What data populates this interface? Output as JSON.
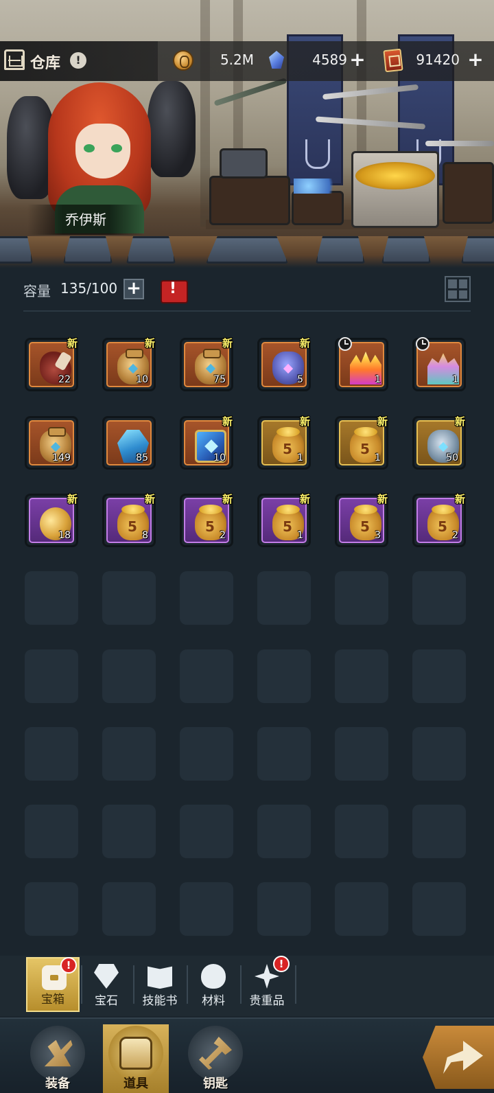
{
  "header": {
    "title": "仓库",
    "info_glyph": "!",
    "gold": "5.2M",
    "gems": "4589",
    "tickets": "91420",
    "plus_glyph": "+"
  },
  "character": {
    "name": "乔伊斯"
  },
  "capacity": {
    "label": "容量",
    "value": "135/100",
    "plus_glyph": "+",
    "alert_glyph": "!"
  },
  "new_label": "新",
  "items": [
    {
      "icon": "meat-icon",
      "rarity": "orange",
      "qty": "22",
      "new": true,
      "timer": false
    },
    {
      "icon": "gold-jar-icon",
      "rarity": "orange",
      "qty": "10",
      "new": true,
      "timer": false
    },
    {
      "icon": "gold-jar-icon",
      "rarity": "orange",
      "qty": "75",
      "new": true,
      "timer": false
    },
    {
      "icon": "dark-jar-icon",
      "rarity": "orange",
      "qty": "5",
      "new": true,
      "timer": false
    },
    {
      "icon": "flame-chest-icon",
      "rarity": "orange",
      "qty": "1",
      "new": false,
      "timer": true
    },
    {
      "icon": "gem-chest-icon",
      "rarity": "orange",
      "qty": "1",
      "new": false,
      "timer": true
    },
    {
      "icon": "gold-jar-icon",
      "rarity": "orange",
      "qty": "149",
      "new": false,
      "timer": false
    },
    {
      "icon": "crystal-icon",
      "rarity": "orange",
      "qty": "85",
      "new": false,
      "timer": false
    },
    {
      "icon": "magic-box-icon",
      "rarity": "orange",
      "qty": "10",
      "new": true,
      "timer": false
    },
    {
      "icon": "coin-bag-icon",
      "rarity": "gold",
      "qty": "1",
      "new": true,
      "timer": false
    },
    {
      "icon": "coin-bag-icon",
      "rarity": "gold",
      "qty": "1",
      "new": true,
      "timer": false
    },
    {
      "icon": "steel-jar-icon",
      "rarity": "gold",
      "qty": "50",
      "new": true,
      "timer": false
    },
    {
      "icon": "coin-stack-icon",
      "rarity": "purple",
      "qty": "18",
      "new": true,
      "timer": false
    },
    {
      "icon": "coin-bag-icon",
      "rarity": "purple",
      "qty": "8",
      "new": true,
      "timer": false
    },
    {
      "icon": "coin-bag-icon",
      "rarity": "purple",
      "qty": "2",
      "new": true,
      "timer": false
    },
    {
      "icon": "coin-bag-icon",
      "rarity": "purple",
      "qty": "1",
      "new": true,
      "timer": false
    },
    {
      "icon": "coin-bag-icon",
      "rarity": "purple",
      "qty": "3",
      "new": true,
      "timer": false
    },
    {
      "icon": "coin-bag-icon",
      "rarity": "purple",
      "qty": "2",
      "new": true,
      "timer": false
    }
  ],
  "categories": [
    {
      "label": "宝箱",
      "icon": "chest-icon",
      "active": true,
      "badge": "!"
    },
    {
      "label": "宝石",
      "icon": "gem-icon",
      "active": false,
      "badge": ""
    },
    {
      "label": "技能书",
      "icon": "book-icon",
      "active": false,
      "badge": ""
    },
    {
      "label": "材料",
      "icon": "material-icon",
      "active": false,
      "badge": ""
    },
    {
      "label": "贵重品",
      "icon": "star-icon",
      "active": false,
      "badge": "!"
    }
  ],
  "nav": [
    {
      "label": "装备",
      "icon": "equipment-icon",
      "active": false
    },
    {
      "label": "道具",
      "icon": "item-icon",
      "active": true
    },
    {
      "label": "钥匙",
      "icon": "key-icon",
      "active": false
    }
  ],
  "colors": {
    "background": "#1b252d",
    "active_tab": "#e5c566",
    "new_tag": "#fff36a",
    "alert": "#d82424"
  }
}
